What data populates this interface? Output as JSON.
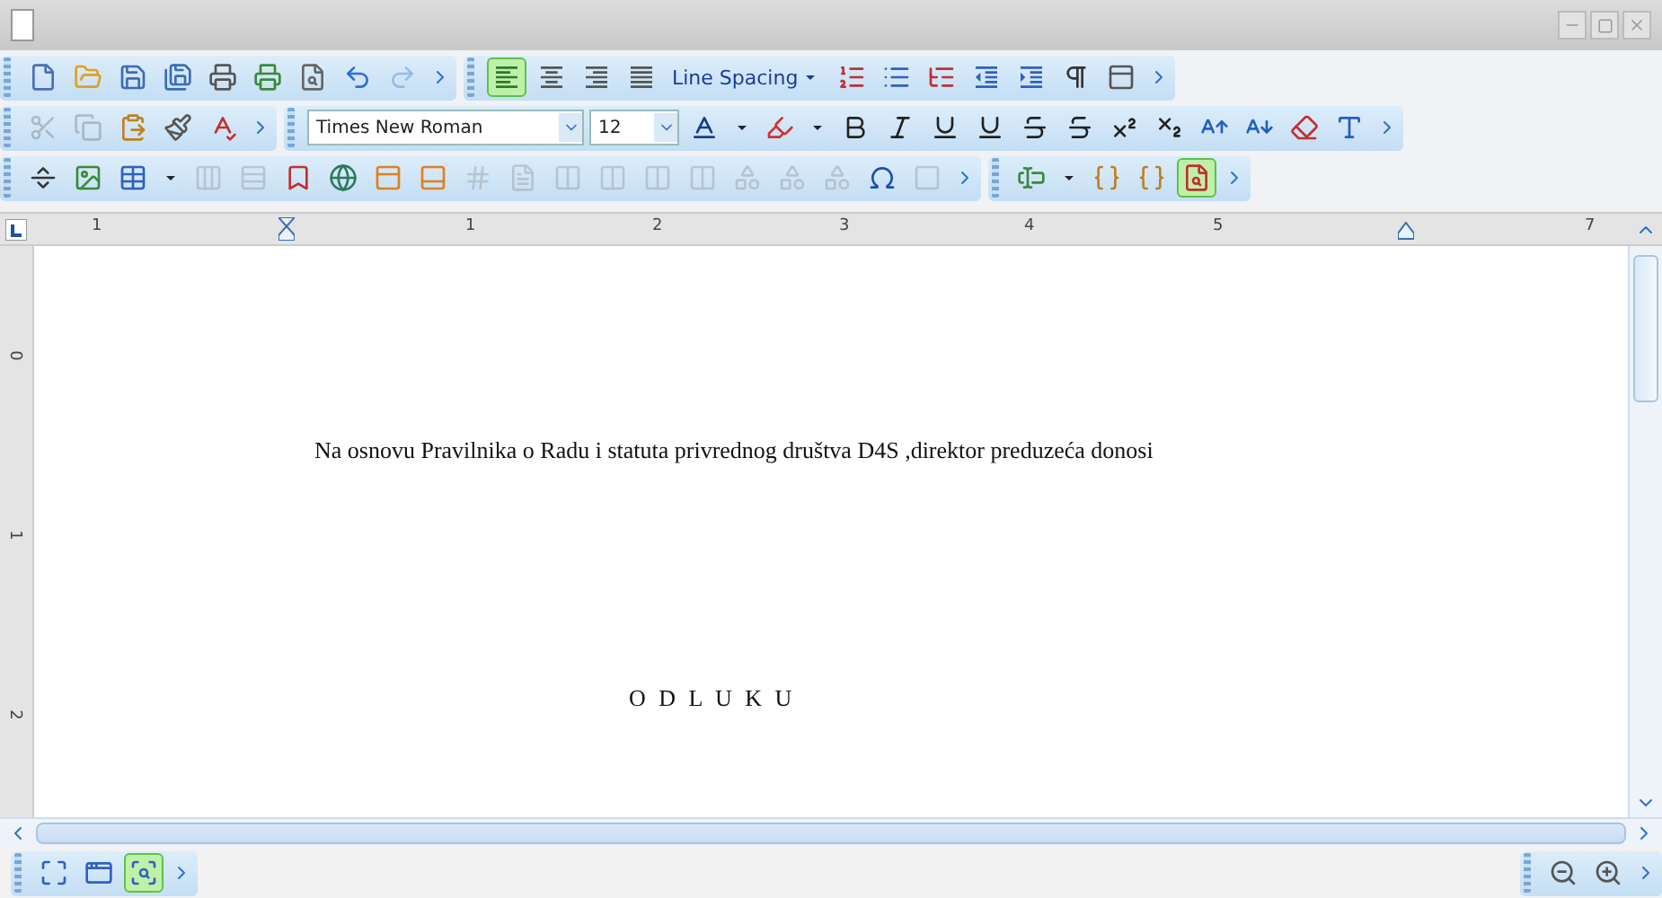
{
  "toolbars": [
    {
      "groups": [
        {
          "items": [
            {
              "kind": "new",
              "selected": false,
              "disabled": false
            },
            {
              "kind": "open",
              "selected": false,
              "disabled": false
            },
            {
              "kind": "save",
              "selected": false,
              "disabled": false
            },
            {
              "kind": "save-as",
              "selected": false,
              "disabled": false
            },
            {
              "kind": "print",
              "selected": false,
              "disabled": false
            },
            {
              "kind": "print-setup",
              "selected": false,
              "disabled": false
            },
            {
              "kind": "preview",
              "selected": false,
              "disabled": false
            },
            {
              "kind": "undo",
              "selected": false,
              "disabled": false
            },
            {
              "kind": "redo",
              "selected": false,
              "disabled": true
            },
            {
              "kind": "more",
              "selected": false,
              "disabled": false
            }
          ]
        },
        {
          "items": [
            {
              "kind": "align-left",
              "selected": true,
              "disabled": false
            },
            {
              "kind": "align-center",
              "selected": false,
              "disabled": false
            },
            {
              "kind": "align-right",
              "selected": false,
              "disabled": false
            },
            {
              "kind": "justify",
              "selected": false,
              "disabled": false
            },
            {
              "kind": "line-spacing",
              "label": "Line Spacing",
              "selected": false,
              "disabled": false
            },
            {
              "kind": "numbered-list",
              "selected": false,
              "disabled": false
            },
            {
              "kind": "bullet-list",
              "selected": false,
              "disabled": false
            },
            {
              "kind": "outline",
              "selected": false,
              "disabled": false
            },
            {
              "kind": "outdent",
              "selected": false,
              "disabled": false
            },
            {
              "kind": "indent",
              "selected": false,
              "disabled": false
            },
            {
              "kind": "pilcrow",
              "selected": false,
              "disabled": false
            },
            {
              "kind": "style",
              "selected": false,
              "disabled": false
            },
            {
              "kind": "more",
              "selected": false,
              "disabled": false
            }
          ]
        }
      ]
    },
    {
      "groups": [
        {
          "items": [
            {
              "kind": "cut",
              "selected": false,
              "disabled": true
            },
            {
              "kind": "copy",
              "selected": false,
              "disabled": true
            },
            {
              "kind": "paste",
              "selected": false,
              "disabled": false
            },
            {
              "kind": "format-painter",
              "selected": false,
              "disabled": false
            },
            {
              "kind": "spelling",
              "selected": false,
              "disabled": false
            },
            {
              "kind": "more",
              "selected": false,
              "disabled": false
            }
          ]
        },
        {
          "items": [
            {
              "kind": "font",
              "value": "Times New Roman"
            },
            {
              "kind": "size",
              "value": "12"
            },
            {
              "kind": "font-color",
              "selected": false,
              "disabled": false
            },
            {
              "kind": "caret",
              "selected": false,
              "disabled": false
            },
            {
              "kind": "highlight",
              "selected": false,
              "disabled": false
            },
            {
              "kind": "caret",
              "selected": false,
              "disabled": false
            },
            {
              "kind": "bold",
              "selected": false,
              "disabled": false
            },
            {
              "kind": "italic",
              "selected": false,
              "disabled": false
            },
            {
              "kind": "underline",
              "selected": false,
              "disabled": false
            },
            {
              "kind": "double-underline",
              "selected": false,
              "disabled": false
            },
            {
              "kind": "strike",
              "selected": false,
              "disabled": false
            },
            {
              "kind": "double-strike",
              "selected": false,
              "disabled": false
            },
            {
              "kind": "superscript",
              "selected": false,
              "disabled": false
            },
            {
              "kind": "subscript",
              "selected": false,
              "disabled": false
            },
            {
              "kind": "grow",
              "selected": false,
              "disabled": false
            },
            {
              "kind": "shrink",
              "selected": false,
              "disabled": false
            },
            {
              "kind": "clear",
              "selected": false,
              "disabled": false
            },
            {
              "kind": "text-style",
              "selected": false,
              "disabled": false
            },
            {
              "kind": "more",
              "selected": false,
              "disabled": false
            }
          ]
        }
      ]
    },
    {
      "groups": [
        {
          "items": [
            {
              "kind": "page-break",
              "selected": false,
              "disabled": false
            },
            {
              "kind": "image",
              "selected": false,
              "disabled": false
            },
            {
              "kind": "table",
              "selected": false,
              "disabled": false
            },
            {
              "kind": "caret",
              "selected": false,
              "disabled": false
            },
            {
              "kind": "insert-column",
              "selected": false,
              "disabled": true
            },
            {
              "kind": "insert-row",
              "selected": false,
              "disabled": true
            },
            {
              "kind": "bookmark",
              "selected": false,
              "disabled": false
            },
            {
              "kind": "hyperlink",
              "selected": false,
              "disabled": false
            },
            {
              "kind": "header",
              "selected": false,
              "disabled": false
            },
            {
              "kind": "footer",
              "selected": false,
              "disabled": false
            },
            {
              "kind": "page-number",
              "selected": false,
              "disabled": true
            },
            {
              "kind": "page-count",
              "selected": false,
              "disabled": true
            },
            {
              "kind": "column",
              "selected": false,
              "disabled": true
            },
            {
              "kind": "column",
              "selected": false,
              "disabled": true
            },
            {
              "kind": "column",
              "selected": false,
              "disabled": true
            },
            {
              "kind": "column",
              "selected": false,
              "disabled": true
            },
            {
              "kind": "shape",
              "selected": false,
              "disabled": true
            },
            {
              "kind": "shape",
              "selected": false,
              "disabled": true
            },
            {
              "kind": "shape",
              "selected": false,
              "disabled": true
            },
            {
              "kind": "symbol",
              "selected": false,
              "disabled": false
            },
            {
              "kind": "frame",
              "selected": false,
              "disabled": true
            },
            {
              "kind": "more",
              "selected": false,
              "disabled": false
            }
          ]
        },
        {
          "items": [
            {
              "kind": "field",
              "selected": false,
              "disabled": false
            },
            {
              "kind": "caret",
              "selected": false,
              "disabled": false
            },
            {
              "kind": "code",
              "selected": false,
              "disabled": false
            },
            {
              "kind": "code",
              "selected": false,
              "disabled": false
            },
            {
              "kind": "find",
              "selected": true,
              "disabled": false
            },
            {
              "kind": "more",
              "selected": false,
              "disabled": false
            }
          ]
        }
      ]
    }
  ],
  "ruler": {
    "labels": [
      "1",
      "1",
      "2",
      "3",
      "4",
      "5",
      "7"
    ]
  },
  "vertical_ruler": {
    "labels": [
      "0",
      "1",
      "2"
    ]
  },
  "document": {
    "paragraph": "Na osnovu Pravilnika o Radu i statuta privrednog društva D4S ,direktor preduzeća donosi",
    "heading": "O D L U K U"
  },
  "status_bar": {
    "left": [
      {
        "kind": "fit",
        "selected": false
      },
      {
        "kind": "layout",
        "selected": false
      },
      {
        "kind": "view",
        "selected": true
      },
      {
        "kind": "more",
        "selected": false
      }
    ],
    "right": [
      {
        "kind": "zoom-out",
        "selected": false
      },
      {
        "kind": "zoom-in",
        "selected": false
      },
      {
        "kind": "more",
        "selected": false
      }
    ]
  }
}
